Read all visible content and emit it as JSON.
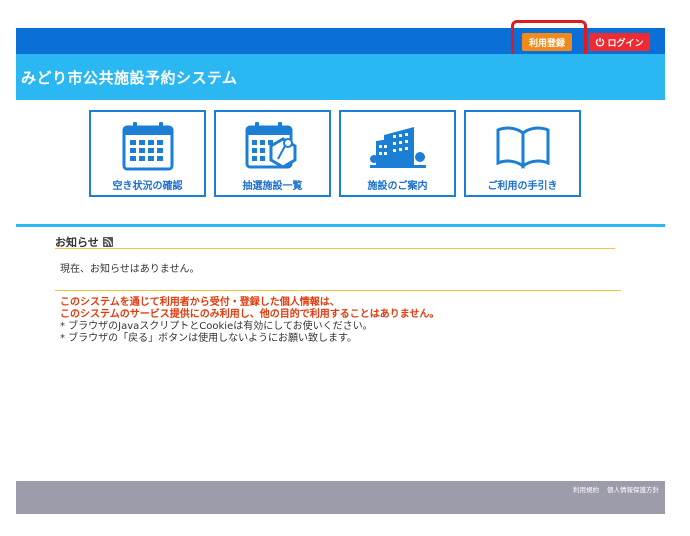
{
  "header": {
    "register_label": "利用登録",
    "login_label": "ログイン",
    "system_title": "みどり市公共施設予約システム"
  },
  "menu": {
    "items": [
      {
        "label": "空き状況の確認",
        "icon": "calendar-icon"
      },
      {
        "label": "抽選施設一覧",
        "icon": "lottery-calendar-icon"
      },
      {
        "label": "施設のご案内",
        "icon": "building-icon"
      },
      {
        "label": "ご利用の手引き",
        "icon": "book-icon"
      }
    ]
  },
  "news": {
    "heading": "お知らせ",
    "body": "現在、お知らせはありません。"
  },
  "notice": {
    "line1": "このシステムを通じて利用者から受付・登録した個人情報は、",
    "line2": "このシステムのサービス提供にのみ利用し、他の目的で利用することはありません。",
    "line3": "* ブラウザのJavaスクリプトとCookieは有効にしてお使いください。",
    "line4": "* ブラウザの「戻る」ボタンは使用しないようにお願い致します。"
  },
  "footer": {
    "terms_label": "利用規約",
    "privacy_label": "個人情報保護方針"
  },
  "colors": {
    "topbar": "#0a6fd6",
    "titlebar": "#2bb8f2",
    "register": "#f08a1c",
    "login": "#ee2b32",
    "tile_border": "#1c7fd6",
    "notice_red": "#e23a0e",
    "footer": "#9d9caa"
  }
}
